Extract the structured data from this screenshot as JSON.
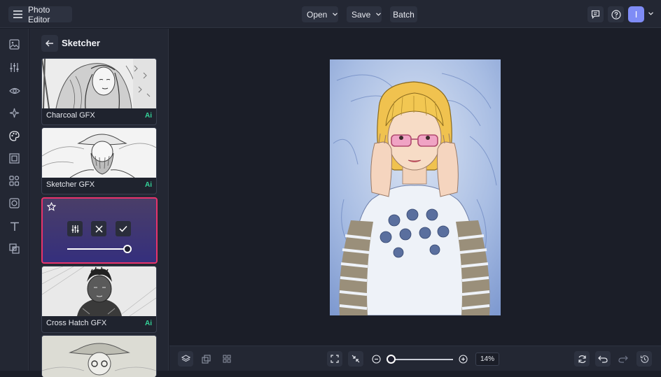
{
  "app": {
    "title": "Photo Editor"
  },
  "topbar": {
    "open_label": "Open",
    "save_label": "Save",
    "batch_label": "Batch",
    "avatar_initial": "I",
    "icons": [
      "menu-icon",
      "chevron-down-icon",
      "comment-icon",
      "help-icon"
    ]
  },
  "rail": {
    "icons": [
      "image-icon",
      "adjustments-icon",
      "eye-icon",
      "sparkle-effects-icon",
      "artsy-palette-icon",
      "frame-icon",
      "graphics-icon",
      "border-icon",
      "text-icon",
      "texture-icon"
    ]
  },
  "panel": {
    "title": "Sketcher",
    "cards": [
      {
        "label": "Charcoal GFX",
        "badge": "Ai"
      },
      {
        "label": "Sketcher GFX",
        "badge": "Ai"
      },
      {
        "label": "Cross Hatch GFX",
        "badge": "Ai"
      }
    ],
    "active_card": {
      "intensity_fraction": 1.0
    }
  },
  "bottombar": {
    "zoom_value": "14%",
    "zoom_slider_fraction": 0.0
  },
  "colors": {
    "accent_border": "#e8336b",
    "ai_badge": "#34d399",
    "avatar": "#7f8cf6",
    "background": "#1b1e28",
    "panel": "#232733"
  }
}
